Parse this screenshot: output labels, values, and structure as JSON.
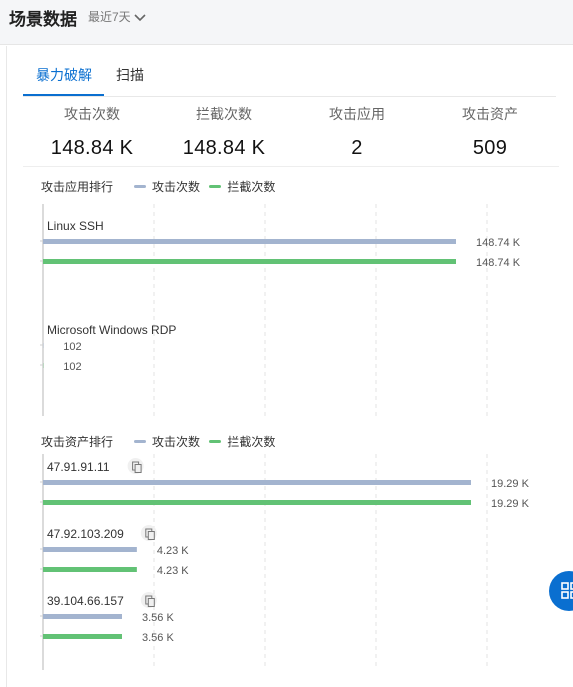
{
  "header": {
    "title": "场景数据",
    "time_range": "最近7天"
  },
  "tabs": [
    {
      "label": "暴力破解",
      "active": true
    },
    {
      "label": "扫描",
      "active": false
    }
  ],
  "stats": [
    {
      "label": "攻击次数",
      "value": "148.84 K"
    },
    {
      "label": "拦截次数",
      "value": "148.84 K"
    },
    {
      "label": "攻击应用",
      "value": "2"
    },
    {
      "label": "攻击资产",
      "value": "509"
    }
  ],
  "colors": {
    "accent": "#0a6fd0",
    "attack": "#a3b4cf",
    "block": "#62c275",
    "grid": "#e3e3e3"
  },
  "icons": {
    "copy": "copy-icon",
    "dropdown": "chevron-down-icon",
    "fab": "grid-icon"
  },
  "chart_data": [
    {
      "type": "bar",
      "title": "攻击应用排行",
      "orientation": "horizontal",
      "legend": [
        "攻击次数",
        "拦截次数"
      ],
      "legend_position": "top",
      "categories": [
        "Linux SSH",
        "Microsoft Windows RDP"
      ],
      "series": [
        {
          "name": "攻击次数",
          "values": [
            148740,
            102
          ],
          "labels": [
            "148.74 K",
            "102"
          ]
        },
        {
          "name": "拦截次数",
          "values": [
            148740,
            102
          ],
          "labels": [
            "148.74 K",
            "102"
          ]
        }
      ],
      "grid": true
    },
    {
      "type": "bar",
      "title": "攻击资产排行",
      "orientation": "horizontal",
      "legend": [
        "攻击次数",
        "拦截次数"
      ],
      "legend_position": "top",
      "categories": [
        "47.91.91.11",
        "47.92.103.209",
        "39.104.66.157"
      ],
      "series": [
        {
          "name": "攻击次数",
          "values": [
            19290,
            4230,
            3560
          ],
          "labels": [
            "19.29 K",
            "4.23 K",
            "3.56 K"
          ]
        },
        {
          "name": "拦截次数",
          "values": [
            19290,
            4230,
            3560
          ],
          "labels": [
            "19.29 K",
            "4.23 K",
            "3.56 K"
          ]
        }
      ],
      "grid": true
    }
  ]
}
